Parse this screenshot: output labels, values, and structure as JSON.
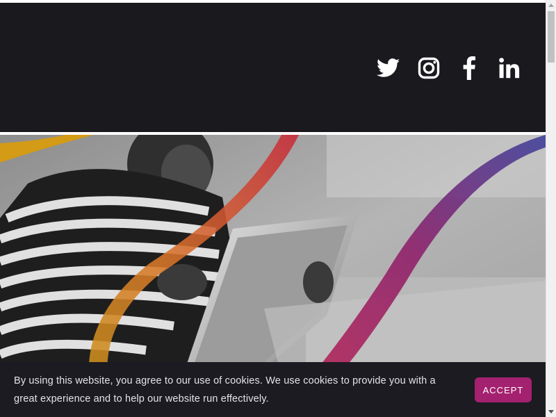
{
  "header": {
    "background_color": "#19191e",
    "social_links": [
      {
        "icon": "twitter-icon"
      },
      {
        "icon": "instagram-icon"
      },
      {
        "icon": "facebook-icon"
      },
      {
        "icon": "linkedin-icon"
      }
    ]
  },
  "hero": {
    "image": "black-and-white photo of a child in a striped shirt using a tablet, with gold, orange, red, magenta and blue decorative ribbon stripes"
  },
  "cookie_banner": {
    "message": "By using this website, you agree to our use of cookies. We use cookies to provide you with a great experience and to help our website run effectively.",
    "accept_label": "ACCEPT",
    "accent_color": "#a3216f"
  }
}
